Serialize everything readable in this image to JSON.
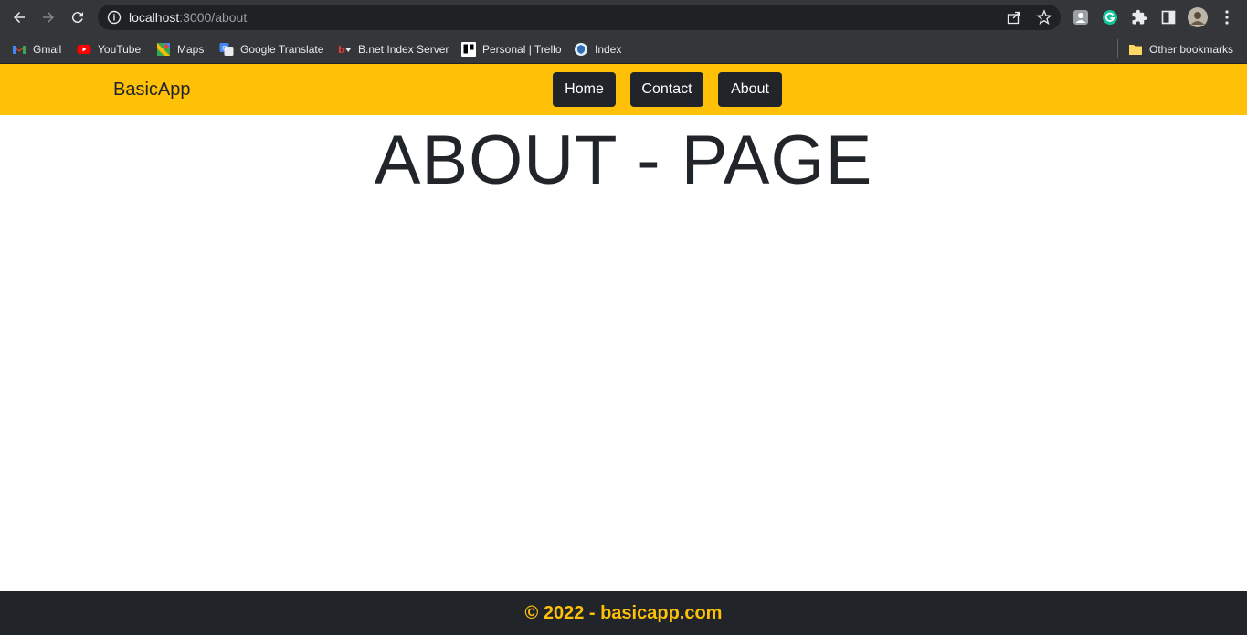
{
  "browser": {
    "url_host": "localhost",
    "url_path": ":3000/about",
    "bookmarks": [
      {
        "label": "Gmail",
        "icon": "gmail-icon"
      },
      {
        "label": "YouTube",
        "icon": "youtube-icon"
      },
      {
        "label": "Maps",
        "icon": "maps-icon"
      },
      {
        "label": "Google Translate",
        "icon": "translate-icon"
      },
      {
        "label": "B.net Index Server",
        "icon": "bnet-icon"
      },
      {
        "label": "Personal | Trello",
        "icon": "trello-icon"
      },
      {
        "label": "Index",
        "icon": "index-icon"
      }
    ],
    "other_bookmarks": "Other bookmarks"
  },
  "navbar": {
    "brand": "BasicApp",
    "links": [
      "Home",
      "Contact",
      "About"
    ],
    "bg_color": "#ffc107",
    "button_color": "#212529"
  },
  "main": {
    "heading": "ABOUT - PAGE"
  },
  "footer": {
    "text": "© 2022 - basicapp.com",
    "text_color": "#ffc107"
  }
}
